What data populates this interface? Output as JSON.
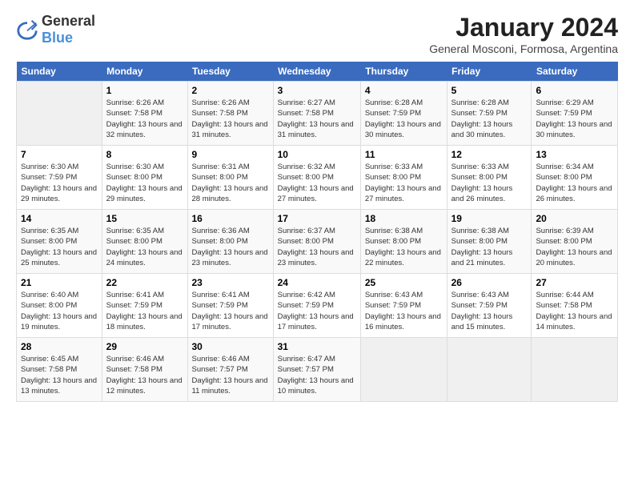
{
  "header": {
    "logo_general": "General",
    "logo_blue": "Blue",
    "title": "January 2024",
    "subtitle": "General Mosconi, Formosa, Argentina"
  },
  "days_of_week": [
    "Sunday",
    "Monday",
    "Tuesday",
    "Wednesday",
    "Thursday",
    "Friday",
    "Saturday"
  ],
  "weeks": [
    [
      {
        "num": "",
        "sunrise": "",
        "sunset": "",
        "daylight": "",
        "empty": true
      },
      {
        "num": "1",
        "sunrise": "Sunrise: 6:26 AM",
        "sunset": "Sunset: 7:58 PM",
        "daylight": "Daylight: 13 hours and 32 minutes."
      },
      {
        "num": "2",
        "sunrise": "Sunrise: 6:26 AM",
        "sunset": "Sunset: 7:58 PM",
        "daylight": "Daylight: 13 hours and 31 minutes."
      },
      {
        "num": "3",
        "sunrise": "Sunrise: 6:27 AM",
        "sunset": "Sunset: 7:58 PM",
        "daylight": "Daylight: 13 hours and 31 minutes."
      },
      {
        "num": "4",
        "sunrise": "Sunrise: 6:28 AM",
        "sunset": "Sunset: 7:59 PM",
        "daylight": "Daylight: 13 hours and 30 minutes."
      },
      {
        "num": "5",
        "sunrise": "Sunrise: 6:28 AM",
        "sunset": "Sunset: 7:59 PM",
        "daylight": "Daylight: 13 hours and 30 minutes."
      },
      {
        "num": "6",
        "sunrise": "Sunrise: 6:29 AM",
        "sunset": "Sunset: 7:59 PM",
        "daylight": "Daylight: 13 hours and 30 minutes."
      }
    ],
    [
      {
        "num": "7",
        "sunrise": "Sunrise: 6:30 AM",
        "sunset": "Sunset: 7:59 PM",
        "daylight": "Daylight: 13 hours and 29 minutes."
      },
      {
        "num": "8",
        "sunrise": "Sunrise: 6:30 AM",
        "sunset": "Sunset: 8:00 PM",
        "daylight": "Daylight: 13 hours and 29 minutes."
      },
      {
        "num": "9",
        "sunrise": "Sunrise: 6:31 AM",
        "sunset": "Sunset: 8:00 PM",
        "daylight": "Daylight: 13 hours and 28 minutes."
      },
      {
        "num": "10",
        "sunrise": "Sunrise: 6:32 AM",
        "sunset": "Sunset: 8:00 PM",
        "daylight": "Daylight: 13 hours and 27 minutes."
      },
      {
        "num": "11",
        "sunrise": "Sunrise: 6:33 AM",
        "sunset": "Sunset: 8:00 PM",
        "daylight": "Daylight: 13 hours and 27 minutes."
      },
      {
        "num": "12",
        "sunrise": "Sunrise: 6:33 AM",
        "sunset": "Sunset: 8:00 PM",
        "daylight": "Daylight: 13 hours and 26 minutes."
      },
      {
        "num": "13",
        "sunrise": "Sunrise: 6:34 AM",
        "sunset": "Sunset: 8:00 PM",
        "daylight": "Daylight: 13 hours and 26 minutes."
      }
    ],
    [
      {
        "num": "14",
        "sunrise": "Sunrise: 6:35 AM",
        "sunset": "Sunset: 8:00 PM",
        "daylight": "Daylight: 13 hours and 25 minutes."
      },
      {
        "num": "15",
        "sunrise": "Sunrise: 6:35 AM",
        "sunset": "Sunset: 8:00 PM",
        "daylight": "Daylight: 13 hours and 24 minutes."
      },
      {
        "num": "16",
        "sunrise": "Sunrise: 6:36 AM",
        "sunset": "Sunset: 8:00 PM",
        "daylight": "Daylight: 13 hours and 23 minutes."
      },
      {
        "num": "17",
        "sunrise": "Sunrise: 6:37 AM",
        "sunset": "Sunset: 8:00 PM",
        "daylight": "Daylight: 13 hours and 23 minutes."
      },
      {
        "num": "18",
        "sunrise": "Sunrise: 6:38 AM",
        "sunset": "Sunset: 8:00 PM",
        "daylight": "Daylight: 13 hours and 22 minutes."
      },
      {
        "num": "19",
        "sunrise": "Sunrise: 6:38 AM",
        "sunset": "Sunset: 8:00 PM",
        "daylight": "Daylight: 13 hours and 21 minutes."
      },
      {
        "num": "20",
        "sunrise": "Sunrise: 6:39 AM",
        "sunset": "Sunset: 8:00 PM",
        "daylight": "Daylight: 13 hours and 20 minutes."
      }
    ],
    [
      {
        "num": "21",
        "sunrise": "Sunrise: 6:40 AM",
        "sunset": "Sunset: 8:00 PM",
        "daylight": "Daylight: 13 hours and 19 minutes."
      },
      {
        "num": "22",
        "sunrise": "Sunrise: 6:41 AM",
        "sunset": "Sunset: 7:59 PM",
        "daylight": "Daylight: 13 hours and 18 minutes."
      },
      {
        "num": "23",
        "sunrise": "Sunrise: 6:41 AM",
        "sunset": "Sunset: 7:59 PM",
        "daylight": "Daylight: 13 hours and 17 minutes."
      },
      {
        "num": "24",
        "sunrise": "Sunrise: 6:42 AM",
        "sunset": "Sunset: 7:59 PM",
        "daylight": "Daylight: 13 hours and 17 minutes."
      },
      {
        "num": "25",
        "sunrise": "Sunrise: 6:43 AM",
        "sunset": "Sunset: 7:59 PM",
        "daylight": "Daylight: 13 hours and 16 minutes."
      },
      {
        "num": "26",
        "sunrise": "Sunrise: 6:43 AM",
        "sunset": "Sunset: 7:59 PM",
        "daylight": "Daylight: 13 hours and 15 minutes."
      },
      {
        "num": "27",
        "sunrise": "Sunrise: 6:44 AM",
        "sunset": "Sunset: 7:58 PM",
        "daylight": "Daylight: 13 hours and 14 minutes."
      }
    ],
    [
      {
        "num": "28",
        "sunrise": "Sunrise: 6:45 AM",
        "sunset": "Sunset: 7:58 PM",
        "daylight": "Daylight: 13 hours and 13 minutes."
      },
      {
        "num": "29",
        "sunrise": "Sunrise: 6:46 AM",
        "sunset": "Sunset: 7:58 PM",
        "daylight": "Daylight: 13 hours and 12 minutes."
      },
      {
        "num": "30",
        "sunrise": "Sunrise: 6:46 AM",
        "sunset": "Sunset: 7:57 PM",
        "daylight": "Daylight: 13 hours and 11 minutes."
      },
      {
        "num": "31",
        "sunrise": "Sunrise: 6:47 AM",
        "sunset": "Sunset: 7:57 PM",
        "daylight": "Daylight: 13 hours and 10 minutes."
      },
      {
        "num": "",
        "sunrise": "",
        "sunset": "",
        "daylight": "",
        "empty": true
      },
      {
        "num": "",
        "sunrise": "",
        "sunset": "",
        "daylight": "",
        "empty": true
      },
      {
        "num": "",
        "sunrise": "",
        "sunset": "",
        "daylight": "",
        "empty": true
      }
    ]
  ]
}
